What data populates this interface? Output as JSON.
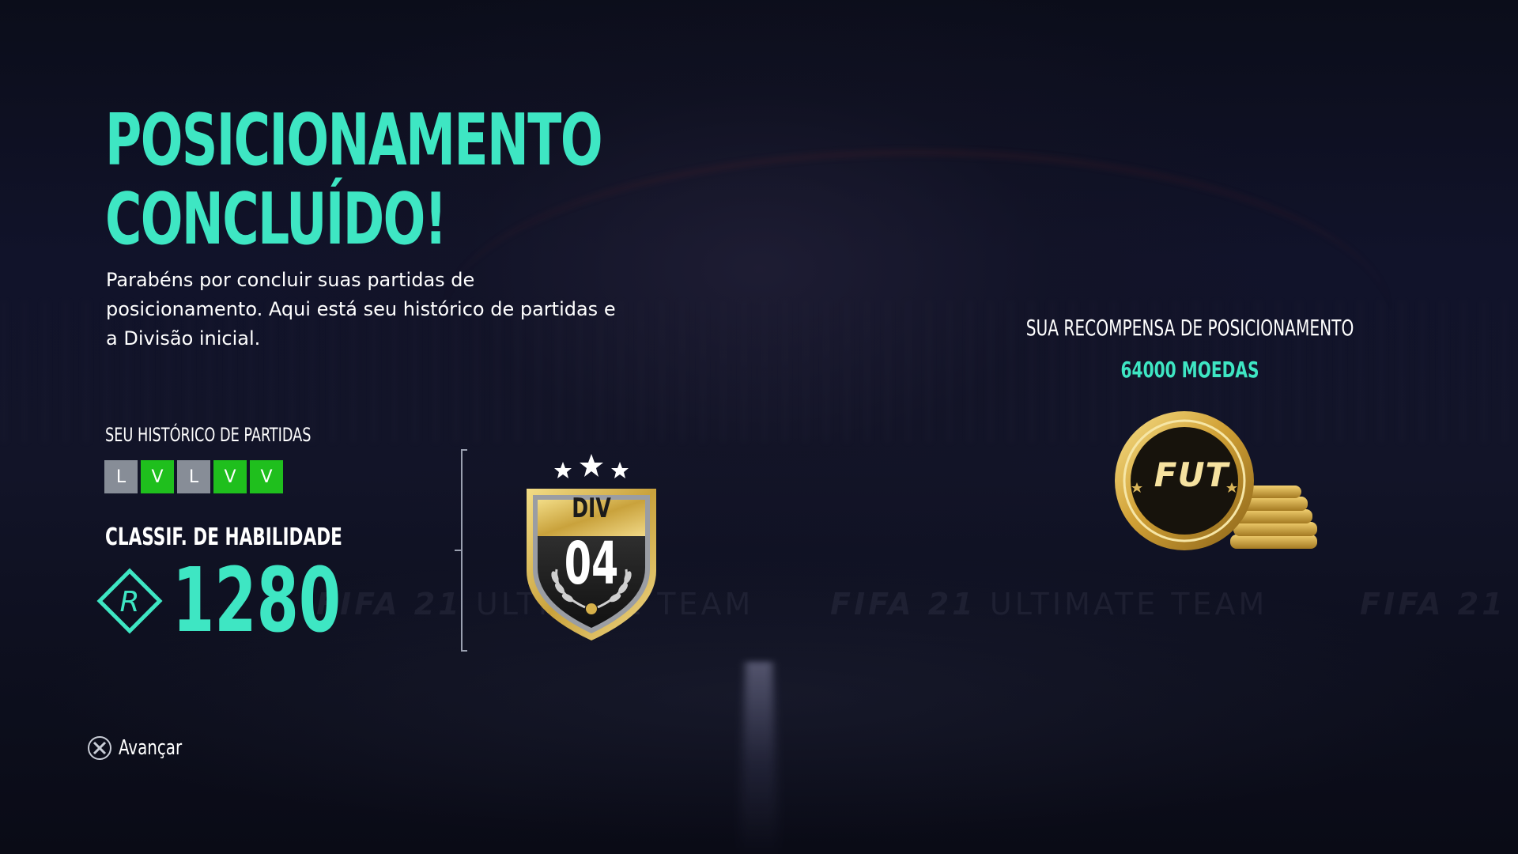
{
  "header": {
    "title_line1": "POSICIONAMENTO",
    "title_line2": "CONCLUÍDO!",
    "intro": "Parabéns por concluir suas partidas de posicionamento. Aqui está seu histórico de partidas e a Divisão inicial."
  },
  "history": {
    "label": "SEU HISTÓRICO DE PARTIDAS",
    "results": [
      {
        "value": "L",
        "type": "loss"
      },
      {
        "value": "V",
        "type": "win"
      },
      {
        "value": "L",
        "type": "loss"
      },
      {
        "value": "V",
        "type": "win"
      },
      {
        "value": "V",
        "type": "win"
      }
    ]
  },
  "skill": {
    "label": "CLASSIF. DE HABILIDADE",
    "rank_letter": "R",
    "value": "1280"
  },
  "division": {
    "label": "DIV",
    "number": "04",
    "stars": 3
  },
  "reward": {
    "title": "SUA RECOMPENSA DE POSICIONAMENTO",
    "amount": "64000 MOEDAS",
    "coin_text": "FUT"
  },
  "background": {
    "banner_bold": "FIFA 21",
    "banner_light": "ULTIMATE TEAM"
  },
  "footer": {
    "advance_label": "Avançar",
    "advance_icon": "cross-button-icon"
  },
  "colors": {
    "accent": "#3ee6c3",
    "win": "#1fbf1d",
    "loss": "#878d97",
    "background": "#0d0f1c",
    "gold": "#d4a93a"
  }
}
